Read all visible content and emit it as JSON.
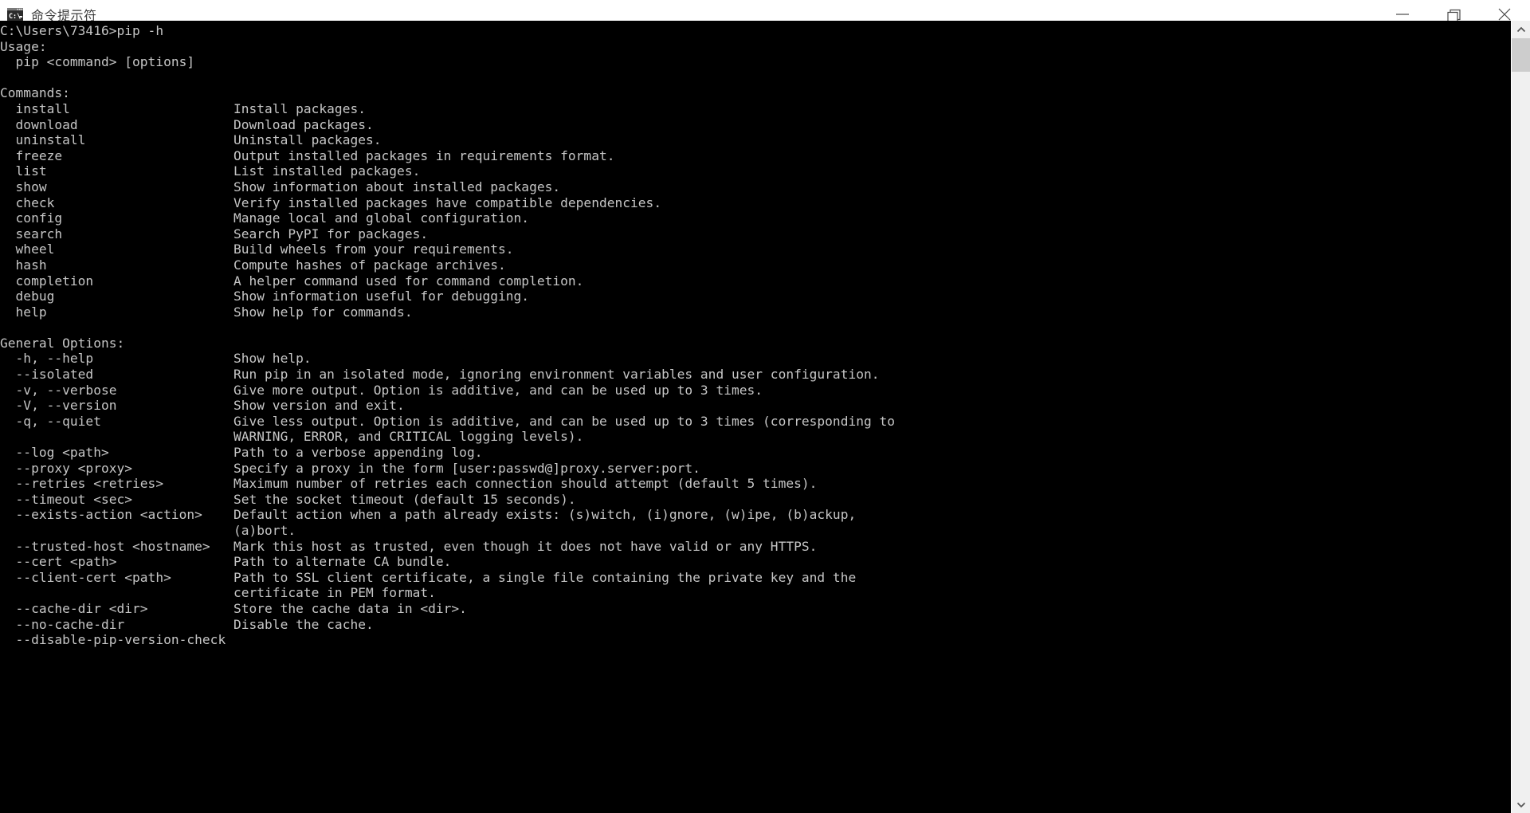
{
  "window": {
    "title": "命令提示符",
    "icon": "command-prompt-icon",
    "controls": {
      "minimize_label": "最小化",
      "maximize_label": "还原",
      "close_label": "关闭"
    },
    "colors": {
      "titlebar_bg": "#ffffff",
      "titlebar_text": "#3b3b3b",
      "console_bg": "#000000",
      "console_text": "#c6c6c6",
      "scrollbar_track": "#f0f0f0",
      "scrollbar_thumb": "#cdcdcd"
    }
  },
  "scrollbar": {
    "up_arrow": "chevron-up-icon",
    "down_arrow": "chevron-down-icon",
    "thumb_position_percent": 2
  },
  "terminal": {
    "prompt": "C:\\Users\\73416>",
    "command": "pip -h",
    "prompt_line": "C:\\Users\\73416>pip -h",
    "output_text": "\nUsage:\n  pip <command> [options]\n\nCommands:\n  install                     Install packages.\n  download                    Download packages.\n  uninstall                   Uninstall packages.\n  freeze                      Output installed packages in requirements format.\n  list                        List installed packages.\n  show                        Show information about installed packages.\n  check                       Verify installed packages have compatible dependencies.\n  config                      Manage local and global configuration.\n  search                      Search PyPI for packages.\n  wheel                       Build wheels from your requirements.\n  hash                        Compute hashes of package archives.\n  completion                  A helper command used for command completion.\n  debug                       Show information useful for debugging.\n  help                        Show help for commands.\n\nGeneral Options:\n  -h, --help                  Show help.\n  --isolated                  Run pip in an isolated mode, ignoring environment variables and user configuration.\n  -v, --verbose               Give more output. Option is additive, and can be used up to 3 times.\n  -V, --version               Show version and exit.\n  -q, --quiet                 Give less output. Option is additive, and can be used up to 3 times (corresponding to\n                              WARNING, ERROR, and CRITICAL logging levels).\n  --log <path>                Path to a verbose appending log.\n  --proxy <proxy>             Specify a proxy in the form [user:passwd@]proxy.server:port.\n  --retries <retries>         Maximum number of retries each connection should attempt (default 5 times).\n  --timeout <sec>             Set the socket timeout (default 15 seconds).\n  --exists-action <action>    Default action when a path already exists: (s)witch, (i)gnore, (w)ipe, (b)ackup,\n                              (a)bort.\n  --trusted-host <hostname>   Mark this host as trusted, even though it does not have valid or any HTTPS.\n  --cert <path>               Path to alternate CA bundle.\n  --client-cert <path>        Path to SSL client certificate, a single file containing the private key and the\n                              certificate in PEM format.\n  --cache-dir <dir>           Store the cache data in <dir>.\n  --no-cache-dir              Disable the cache.\n  --disable-pip-version-check"
  },
  "help_content": {
    "usage_heading": "Usage:",
    "usage_line": "pip <command> [options]",
    "commands_heading": "Commands:",
    "commands": [
      {
        "name": "install",
        "description": "Install packages."
      },
      {
        "name": "download",
        "description": "Download packages."
      },
      {
        "name": "uninstall",
        "description": "Uninstall packages."
      },
      {
        "name": "freeze",
        "description": "Output installed packages in requirements format."
      },
      {
        "name": "list",
        "description": "List installed packages."
      },
      {
        "name": "show",
        "description": "Show information about installed packages."
      },
      {
        "name": "check",
        "description": "Verify installed packages have compatible dependencies."
      },
      {
        "name": "config",
        "description": "Manage local and global configuration."
      },
      {
        "name": "search",
        "description": "Search PyPI for packages."
      },
      {
        "name": "wheel",
        "description": "Build wheels from your requirements."
      },
      {
        "name": "hash",
        "description": "Compute hashes of package archives."
      },
      {
        "name": "completion",
        "description": "A helper command used for command completion."
      },
      {
        "name": "debug",
        "description": "Show information useful for debugging."
      },
      {
        "name": "help",
        "description": "Show help for commands."
      }
    ],
    "general_options_heading": "General Options:",
    "general_options": [
      {
        "flag": "-h, --help",
        "description": "Show help."
      },
      {
        "flag": "--isolated",
        "description": "Run pip in an isolated mode, ignoring environment variables and user configuration."
      },
      {
        "flag": "-v, --verbose",
        "description": "Give more output. Option is additive, and can be used up to 3 times."
      },
      {
        "flag": "-V, --version",
        "description": "Show version and exit."
      },
      {
        "flag": "-q, --quiet",
        "description": "Give less output. Option is additive, and can be used up to 3 times (corresponding to WARNING, ERROR, and CRITICAL logging levels)."
      },
      {
        "flag": "--log <path>",
        "description": "Path to a verbose appending log."
      },
      {
        "flag": "--proxy <proxy>",
        "description": "Specify a proxy in the form [user:passwd@]proxy.server:port."
      },
      {
        "flag": "--retries <retries>",
        "description": "Maximum number of retries each connection should attempt (default 5 times)."
      },
      {
        "flag": "--timeout <sec>",
        "description": "Set the socket timeout (default 15 seconds)."
      },
      {
        "flag": "--exists-action <action>",
        "description": "Default action when a path already exists: (s)witch, (i)gnore, (w)ipe, (b)ackup, (a)bort."
      },
      {
        "flag": "--trusted-host <hostname>",
        "description": "Mark this host as trusted, even though it does not have valid or any HTTPS."
      },
      {
        "flag": "--cert <path>",
        "description": "Path to alternate CA bundle."
      },
      {
        "flag": "--client-cert <path>",
        "description": "Path to SSL client certificate, a single file containing the private key and the certificate in PEM format."
      },
      {
        "flag": "--cache-dir <dir>",
        "description": "Store the cache data in <dir>."
      },
      {
        "flag": "--no-cache-dir",
        "description": "Disable the cache."
      },
      {
        "flag": "--disable-pip-version-check",
        "description": ""
      }
    ]
  }
}
